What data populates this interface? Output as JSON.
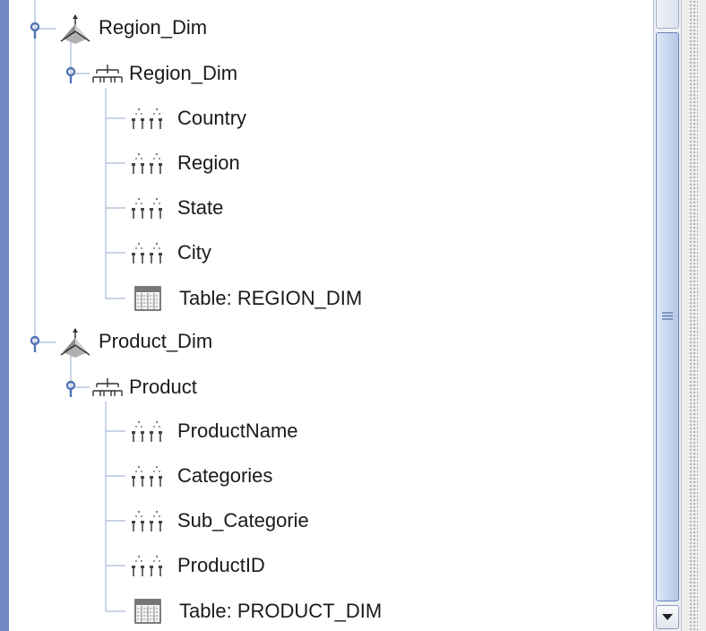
{
  "tree": {
    "dimensions": [
      {
        "label": "Region_Dim",
        "icon": "dimension-icon",
        "hierarchy": {
          "label": "Region_Dim",
          "icon": "hierarchy-icon",
          "children": [
            {
              "label": "Country",
              "icon": "level-icon"
            },
            {
              "label": "Region",
              "icon": "level-icon"
            },
            {
              "label": "State",
              "icon": "level-icon"
            },
            {
              "label": "City",
              "icon": "level-icon"
            },
            {
              "label": "Table: REGION_DIM",
              "icon": "table-icon"
            }
          ]
        }
      },
      {
        "label": "Product_Dim",
        "icon": "dimension-icon",
        "hierarchy": {
          "label": "Product",
          "icon": "hierarchy-icon",
          "children": [
            {
              "label": "ProductName",
              "icon": "level-icon"
            },
            {
              "label": "Categories",
              "icon": "level-icon"
            },
            {
              "label": "Sub_Categorie",
              "icon": "level-icon"
            },
            {
              "label": "ProductID",
              "icon": "level-icon"
            },
            {
              "label": "Table: PRODUCT_DIM",
              "icon": "table-icon"
            }
          ]
        }
      }
    ]
  },
  "colors": {
    "accent_bar": "#6f88c5",
    "tree_line": "#a9b9d6",
    "expander": "#4f74b5",
    "text": "#1a1a1a"
  }
}
